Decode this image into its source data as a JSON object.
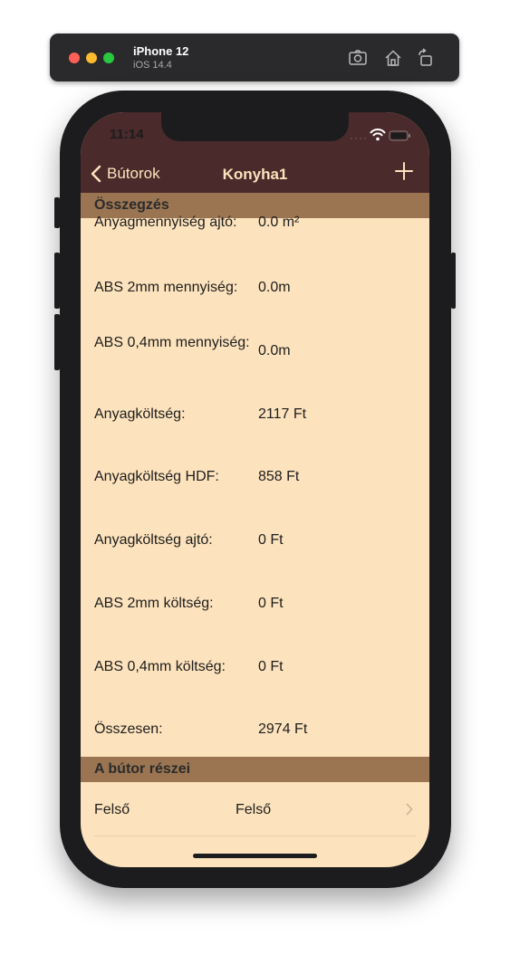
{
  "simulator": {
    "device_name": "iPhone 12",
    "os_version": "iOS 14.4",
    "icons": [
      "screenshot-icon",
      "home-icon",
      "rotate-icon"
    ]
  },
  "status_bar": {
    "time": "11:14"
  },
  "nav": {
    "back_label": "Bútorok",
    "title": "Konyha1"
  },
  "summary": {
    "header": "Összegzés",
    "rows": [
      {
        "label": "Anyagmennyiség ajtó:",
        "value": "0.0 m²"
      },
      {
        "label": "ABS 2mm mennyiség:",
        "value": "0.0m"
      },
      {
        "label": "ABS 0,4mm mennyiség:",
        "value": "0.0m"
      },
      {
        "label": "Anyagköltség:",
        "value": "2117 Ft"
      },
      {
        "label": "Anyagköltség HDF:",
        "value": "858 Ft"
      },
      {
        "label": "Anyagköltség ajtó:",
        "value": "0 Ft"
      },
      {
        "label": "ABS 2mm költség:",
        "value": "0 Ft"
      },
      {
        "label": "ABS 0,4mm költség:",
        "value": "0 Ft"
      },
      {
        "label": "Összesen:",
        "value": "2974 Ft"
      }
    ]
  },
  "parts": {
    "header": "A bútor részei",
    "items": [
      {
        "label": "Felső",
        "value": "Felső"
      }
    ]
  },
  "colors": {
    "header_bg": "#4a2a2b",
    "section_bg": "#9b7552",
    "content_bg": "#fde3bd",
    "nav_text": "#fde3bd"
  }
}
